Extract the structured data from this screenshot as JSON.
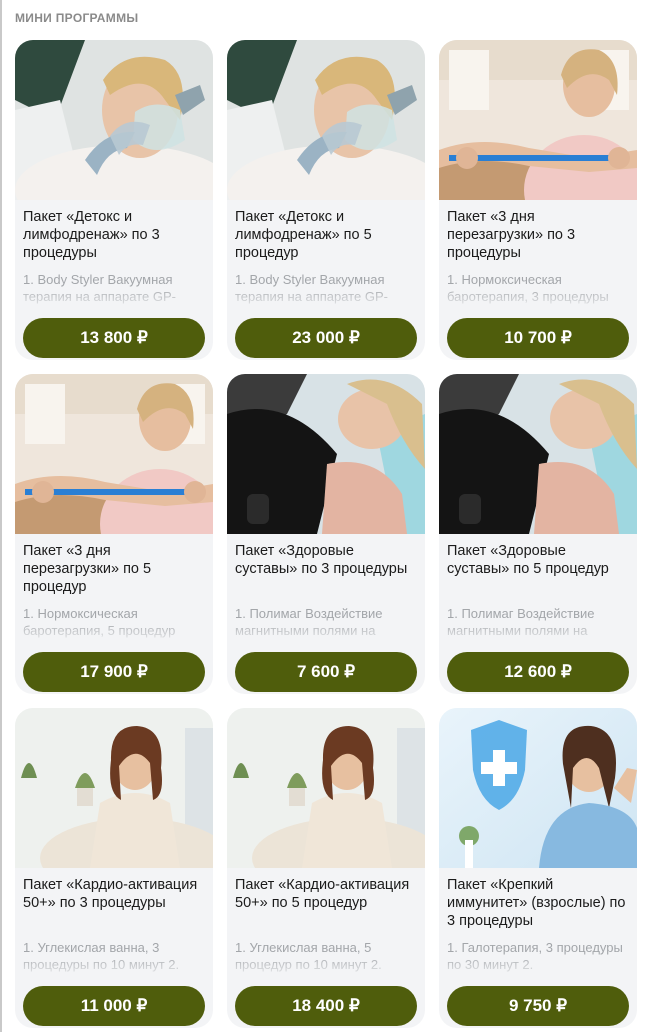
{
  "section": {
    "title": "МИНИ ПРОГРАММЫ"
  },
  "cards": [
    {
      "title": "Пакет «Детокс и лимфодренаж» по 3 процедуры",
      "description": "1. Body Styler Вакуумная терапия на аппарате GP-",
      "price": "13 800 ₽",
      "image": "woman-oxygen-mask-photo"
    },
    {
      "title": "Пакет «Детокс и лимфодренаж» по 5 процедур",
      "description": "1. Body Styler Вакуумная терапия на аппарате GP-",
      "price": "23 000 ₽",
      "image": "woman-oxygen-mask-photo"
    },
    {
      "title": "Пакет «3 дня перезагрузки» по 3 процедуры",
      "description": "1. Нормоксическая баротерапия, 3 процедуры",
      "price": "10 700 ₽",
      "image": "woman-resistance-band-photo"
    },
    {
      "title": "Пакет «3 дня перезагрузки» по 5 процедур",
      "description": "1. Нормоксическая баротерапия, 5 процедур",
      "price": "17 900 ₽",
      "image": "woman-resistance-band-photo"
    },
    {
      "title": "Пакет «Здоровые суставы» по 3 процедуры",
      "description": "1. Полимаг Воздействие магнитными полями на",
      "price": "7 600 ₽",
      "image": "woman-magnetotherapy-photo"
    },
    {
      "title": "Пакет «Здоровые суставы» по 5 процедур",
      "description": "1. Полимаг Воздействие магнитными полями на",
      "price": "12 600 ₽",
      "image": "woman-magnetotherapy-photo"
    },
    {
      "title": "Пакет «Кардио-активация 50+» по 3 процедуры",
      "description": "1. Углекислая ванна, 3 процедуры по 10 минут 2.",
      "price": "11 000 ₽",
      "image": "woman-armchair-photo"
    },
    {
      "title": "Пакет «Кардио-активация 50+» по 5 процедур",
      "description": "1. Углекислая ванна, 5 процедур по 10 минут 2.",
      "price": "18 400 ₽",
      "image": "woman-armchair-photo"
    },
    {
      "title": "Пакет «Крепкий иммунитет» (взрослые) по 3 процедуры",
      "description": "1. Галотерапия, 3 процедуры по 30 минут 2.",
      "price": "9 750 ₽",
      "image": "woman-immunity-shield-photo"
    }
  ],
  "colors": {
    "accent": "#4f5d0c",
    "card_bg": "#f3f4f6",
    "muted_text": "#a3a6aa"
  }
}
